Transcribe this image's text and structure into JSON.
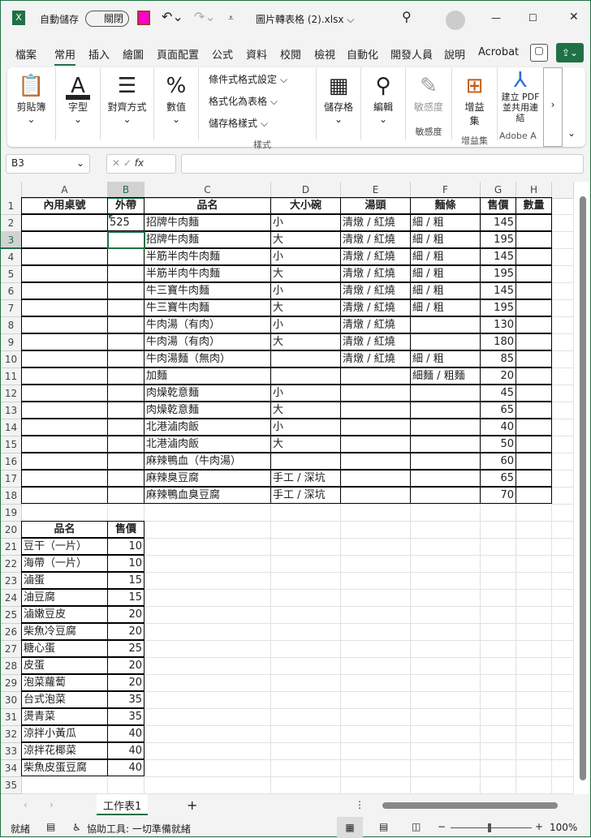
{
  "title": {
    "autosave": "自動儲存",
    "toggle": "關閉",
    "filename": "圖片轉表格 (2).xlsx ⌵"
  },
  "tabs": [
    "檔案",
    "常用",
    "插入",
    "繪圖",
    "頁面配置",
    "公式",
    "資料",
    "校閱",
    "檢視",
    "自動化",
    "開發人員",
    "說明",
    "Acrobat"
  ],
  "ribbon": {
    "clipboard": "剪貼簿",
    "font": "字型",
    "align": "對齊方式",
    "number": "數值",
    "cond": "條件式格式設定 ⌵",
    "table": "格式化為表格 ⌵",
    "styles": "儲存格樣式 ⌵",
    "styles_group": "樣式",
    "cells": "儲存格",
    "edit": "編輯",
    "sens": "敏感度",
    "sens_group": "敏感度",
    "addins": "增益集",
    "addins_group": "增益集",
    "adobe": "建立 PDF 並共用連結",
    "adobe_group": "Adobe A"
  },
  "formula": {
    "namebox": "B3",
    "fx": "fx",
    "value": ""
  },
  "columns": [
    "A",
    "B",
    "C",
    "D",
    "E",
    "F",
    "G",
    "H"
  ],
  "selected": "B3",
  "rows": [
    [
      "內用桌號",
      "外帶",
      "品名",
      "大小碗",
      "湯頭",
      "麵條",
      "售價",
      "數量"
    ],
    [
      "",
      "525",
      "招牌牛肉麵",
      "小",
      "清燉 / 紅燒",
      "細 / 粗",
      "145",
      ""
    ],
    [
      "",
      "",
      "招牌牛肉麵",
      "大",
      "清燉 / 紅燒",
      "細 / 粗",
      "195",
      ""
    ],
    [
      "",
      "",
      "半筋半肉牛肉麵",
      "小",
      "清燉 / 紅燒",
      "細 / 粗",
      "145",
      ""
    ],
    [
      "",
      "",
      "半筋半肉牛肉麵",
      "大",
      "清燉 / 紅燒",
      "細 / 粗",
      "195",
      ""
    ],
    [
      "",
      "",
      "牛三寶牛肉麵",
      "小",
      "清燉 / 紅燒",
      "細 / 粗",
      "145",
      ""
    ],
    [
      "",
      "",
      "牛三寶牛肉麵",
      "大",
      "清燉 / 紅燒",
      "細 / 粗",
      "195",
      ""
    ],
    [
      "",
      "",
      "牛肉湯（有肉）",
      "小",
      "清燉 / 紅燒",
      "",
      "130",
      ""
    ],
    [
      "",
      "",
      "牛肉湯（有肉）",
      "大",
      "清燉 / 紅燒",
      "",
      "180",
      ""
    ],
    [
      "",
      "",
      "牛肉湯麵（無肉）",
      "",
      "清燉 / 紅燒",
      "細 / 粗",
      "85",
      ""
    ],
    [
      "",
      "",
      "加麵",
      "",
      "",
      "細麵 / 粗麵",
      "20",
      ""
    ],
    [
      "",
      "",
      "肉燥乾意麵",
      "小",
      "",
      "",
      "45",
      ""
    ],
    [
      "",
      "",
      "肉燥乾意麵",
      "大",
      "",
      "",
      "65",
      ""
    ],
    [
      "",
      "",
      "北港滷肉飯",
      "小",
      "",
      "",
      "40",
      ""
    ],
    [
      "",
      "",
      "北港滷肉飯",
      "大",
      "",
      "",
      "50",
      ""
    ],
    [
      "",
      "",
      "麻辣鴨血（牛肉湯）",
      "",
      "",
      "",
      "60",
      ""
    ],
    [
      "",
      "",
      "麻辣臭豆腐",
      "手工 / 深坑",
      "",
      "",
      "65",
      ""
    ],
    [
      "",
      "",
      "麻辣鴨血臭豆腐",
      "手工 / 深坑",
      "",
      "",
      "70",
      ""
    ],
    [
      "",
      "",
      "",
      "",
      "",
      "",
      "",
      ""
    ],
    [
      "品名",
      "售價",
      "",
      "",
      "",
      "",
      "",
      ""
    ],
    [
      "豆干（一片）",
      "10",
      "",
      "",
      "",
      "",
      "",
      ""
    ],
    [
      "海帶（一片）",
      "10",
      "",
      "",
      "",
      "",
      "",
      ""
    ],
    [
      "滷蛋",
      "15",
      "",
      "",
      "",
      "",
      "",
      ""
    ],
    [
      "油豆腐",
      "15",
      "",
      "",
      "",
      "",
      "",
      ""
    ],
    [
      "滷嫩豆皮",
      "20",
      "",
      "",
      "",
      "",
      "",
      ""
    ],
    [
      "柴魚冷豆腐",
      "20",
      "",
      "",
      "",
      "",
      "",
      ""
    ],
    [
      "糖心蛋",
      "25",
      "",
      "",
      "",
      "",
      "",
      ""
    ],
    [
      "皮蛋",
      "20",
      "",
      "",
      "",
      "",
      "",
      ""
    ],
    [
      "泡菜蘿蔔",
      "20",
      "",
      "",
      "",
      "",
      "",
      ""
    ],
    [
      "台式泡菜",
      "35",
      "",
      "",
      "",
      "",
      "",
      ""
    ],
    [
      "燙青菜",
      "35",
      "",
      "",
      "",
      "",
      "",
      ""
    ],
    [
      "涼拌小黃瓜",
      "40",
      "",
      "",
      "",
      "",
      "",
      ""
    ],
    [
      "涼拌花椰菜",
      "40",
      "",
      "",
      "",
      "",
      "",
      ""
    ],
    [
      "柴魚皮蛋豆腐",
      "40",
      "",
      "",
      "",
      "",
      "",
      ""
    ],
    [
      "",
      "",
      "",
      "",
      "",
      "",
      "",
      ""
    ]
  ],
  "sheet": {
    "name": "工作表1",
    "add": "+"
  },
  "status": {
    "ready": "就緒",
    "access": "協助工具: 一切準備就緒",
    "zoom": "100%"
  }
}
